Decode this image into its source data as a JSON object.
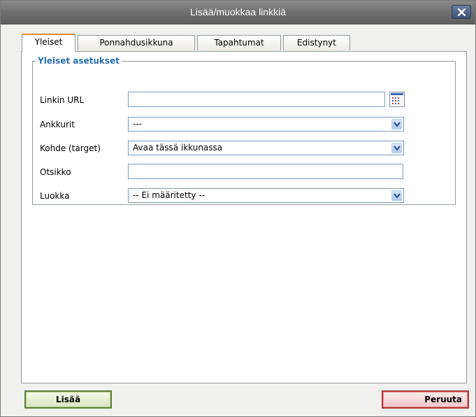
{
  "dialog": {
    "title": "Lisää/muokkaa linkkiä"
  },
  "tabs": [
    {
      "label": "Yleiset",
      "active": true
    },
    {
      "label": "Ponnahdusikkuna",
      "active": false
    },
    {
      "label": "Tapahtumat",
      "active": false
    },
    {
      "label": "Edistynyt",
      "active": false
    }
  ],
  "general": {
    "legend": "Yleiset asetukset",
    "url": {
      "label": "Linkin URL",
      "value": ""
    },
    "anchors": {
      "label": "Ankkurit",
      "selected": "---"
    },
    "target": {
      "label": "Kohde (target)",
      "selected": "Avaa tässä ikkunassa"
    },
    "title": {
      "label": "Otsikko",
      "value": ""
    },
    "class": {
      "label": "Luokka",
      "selected": "-- Ei määritetty --"
    }
  },
  "buttons": {
    "insert": "Lisää",
    "cancel": "Peruuta"
  },
  "colors": {
    "accent_legend": "#2b6fb6",
    "active_tab_border": "#e68b2c",
    "insert_border": "#5f7f3a",
    "cancel_border": "#b03a3a"
  },
  "icons": {
    "close": "close-icon",
    "browse": "browse-list-icon",
    "dropdown": "chevron-down-icon"
  }
}
